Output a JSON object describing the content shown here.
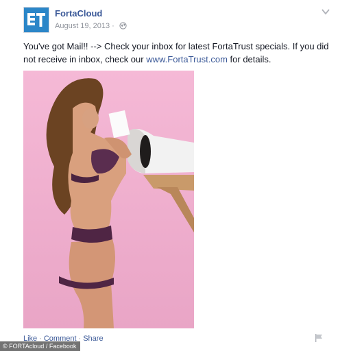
{
  "post": {
    "page_name": "FortaCloud",
    "date": "August 19, 2013 ·",
    "text_before_link": "You've got Mail!! --> Check your inbox for latest FortaTrust specials. If you did not receive in inbox, check our ",
    "link_text": "www.FortaTrust.com",
    "text_after_link": " for details.",
    "privacy_icon": "globe-icon",
    "menu_icon": "chevron-down-icon"
  },
  "actions": {
    "like": "Like",
    "comment": "Comment",
    "share": "Share",
    "separator": "·",
    "flag_icon": "flag-icon"
  },
  "photo": {
    "subject": "photo of woman in lingerie beside mailbox"
  },
  "credit": "© FORTAcloud / Facebook",
  "colors": {
    "link": "#3b5998",
    "text": "#141823",
    "meta": "#90949c",
    "photo_background": "#f0b6d2",
    "logo_blue": "#2b86c8"
  }
}
